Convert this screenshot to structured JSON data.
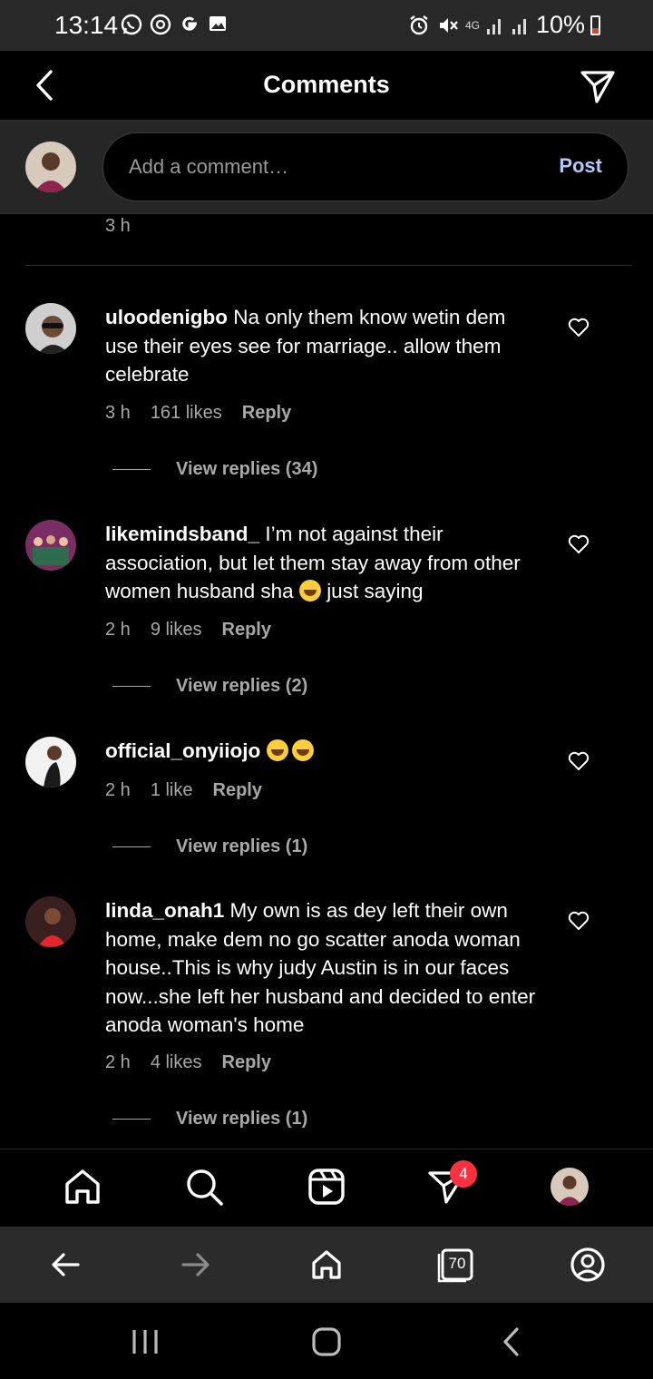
{
  "status_bar": {
    "time": "13:14",
    "network": "4G",
    "battery": "10%"
  },
  "header": {
    "title": "Comments"
  },
  "composer": {
    "placeholder": "Add a comment…",
    "post_label": "Post"
  },
  "previous_comment_time": "3 h",
  "comments": [
    {
      "username": "uloodenigbo",
      "text": "Na only them know wetin dem use their eyes see for marriage.. allow them celebrate",
      "time": "3 h",
      "likes": "161 likes",
      "reply_label": "Reply",
      "view_replies": "View replies (34)"
    },
    {
      "username": "likemindsband_",
      "text": "I’m not against their association, but let them stay away from other women husband sha",
      "text_after_emoji": "just saying",
      "time": "2 h",
      "likes": "9 likes",
      "reply_label": "Reply",
      "view_replies": "View replies (2)"
    },
    {
      "username": "official_onyiiojo",
      "text": "",
      "time": "2 h",
      "likes": "1 like",
      "reply_label": "Reply",
      "view_replies": "View replies (1)"
    },
    {
      "username": "linda_onah1",
      "text": "My own is as dey left their own home, make dem no go scatter anoda woman house..This is why judy Austin is in our faces now...she left her husband and decided to enter anoda woman's home",
      "time": "2 h",
      "likes": "4 likes",
      "reply_label": "Reply",
      "view_replies": "View replies (1)"
    }
  ],
  "bottom_nav": {
    "items": [
      "home-icon",
      "search-icon",
      "reels-icon",
      "direct-icon",
      "profile-avatar"
    ],
    "direct_badge": "4"
  },
  "browser_bar": {
    "tabs_count": "70"
  },
  "colors": {
    "background": "#000000",
    "status_bar": "#282828",
    "composer": "#262626",
    "post_link": "#b3c8f5",
    "secondary_text": "#a8a8a8",
    "badge": "#ff3040"
  }
}
